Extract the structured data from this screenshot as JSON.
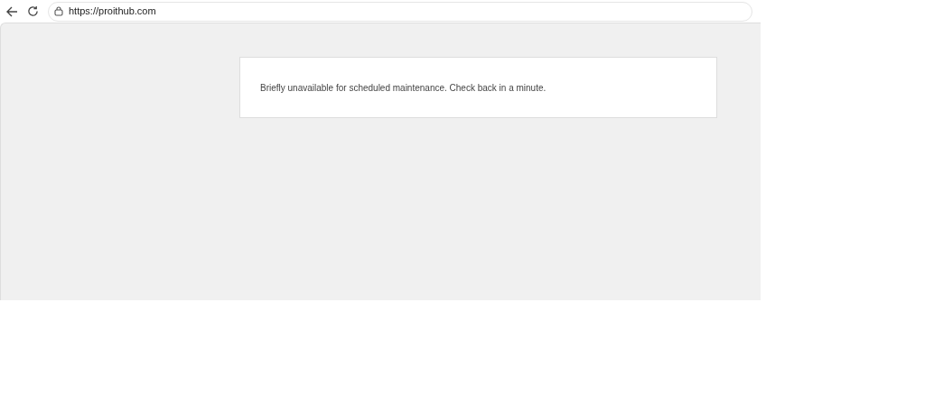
{
  "address_bar": {
    "url": "https://proithub.com"
  },
  "message": "Briefly unavailable for scheduled maintenance. Check back in a minute."
}
